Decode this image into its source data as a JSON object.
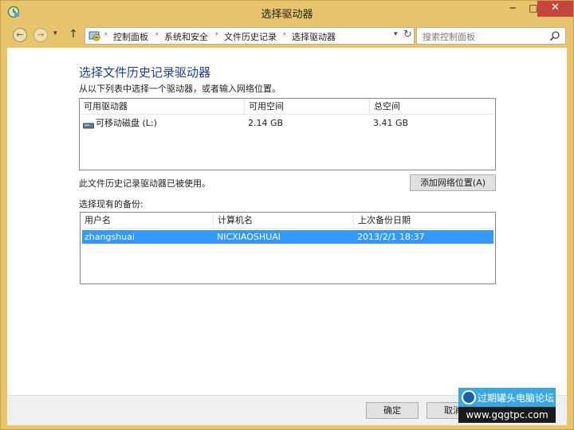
{
  "window": {
    "title": "选择驱动器",
    "controls": {
      "minimize": "─",
      "maximize": "□",
      "close": "✕"
    }
  },
  "nav": {
    "back_glyph": "←",
    "forward_glyph": "→",
    "recent_glyph": "▾",
    "up_glyph": "↑",
    "breadcrumbs": [
      "控制面板",
      "系统和安全",
      "文件历史记录",
      "选择驱动器"
    ],
    "crumb_separator": "›",
    "dropdown_glyph": "▾",
    "refresh_glyph": "↻",
    "search_placeholder": "搜索控制面板"
  },
  "main": {
    "heading": "选择文件历史记录驱动器",
    "description": "从以下列表中选择一个驱动器，或者输入网络位置。",
    "drives_table": {
      "columns": [
        "可用驱动器",
        "可用空间",
        "总空间"
      ],
      "rows": [
        {
          "name": "可移动磁盘 (L:)",
          "free": "2.14 GB",
          "total": "3.41 GB",
          "icon": "removable-drive-icon"
        }
      ]
    },
    "status": "此文件历史记录驱动器已被使用。",
    "add_network_button": "添加网络位置(A)",
    "backup_label": "选择现有的备份:",
    "backups_table": {
      "columns": [
        "用户名",
        "计算机名",
        "上次备份日期"
      ],
      "rows": [
        {
          "user": "zhangshuai",
          "computer": "NICXIAOSHUAI",
          "date": "2013/2/1 18:37",
          "selected": true
        }
      ]
    }
  },
  "footer": {
    "ok": "确定",
    "cancel": "取消"
  },
  "watermark": {
    "brand": "过期罐头电脑论坛",
    "url": "www.gqgtpc.com"
  },
  "colors": {
    "window_frame": "#e8c46c",
    "heading": "#1f3f8a",
    "selection": "#3399ff",
    "close_button": "#c7463c"
  }
}
